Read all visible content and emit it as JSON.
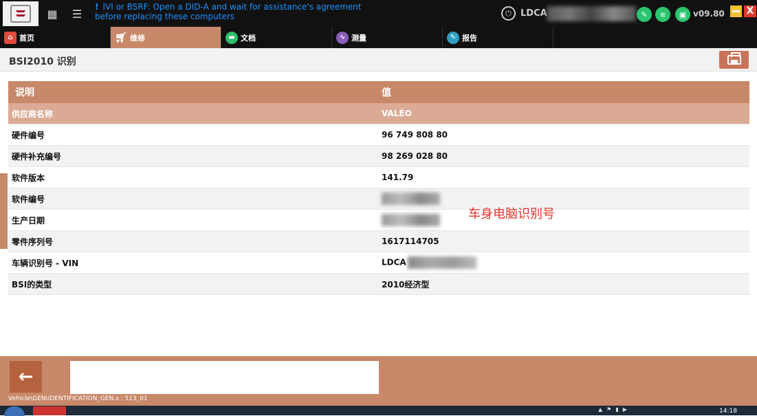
{
  "topbar": {
    "message_bang": "!",
    "message": "IVI or BSRF: Open a DID-A and wait for assistance's agreement before replacing these computers",
    "vin_prefix": "LDCA",
    "version": "v09.80",
    "close_glyph": "X"
  },
  "tabs": [
    {
      "label": "首页",
      "icon": "home-icon"
    },
    {
      "label": "维修",
      "icon": "cart-icon",
      "active": true
    },
    {
      "label": "文档",
      "icon": "folder-icon"
    },
    {
      "label": "测量",
      "icon": "waveform-icon"
    },
    {
      "label": "报告",
      "icon": "report-icon"
    }
  ],
  "page": {
    "title": "BSI2010 识别"
  },
  "table": {
    "header": {
      "col1": "说明",
      "col2": "值"
    },
    "rows": [
      {
        "label": "供应商名称",
        "value": "VALÉO"
      },
      {
        "label": "硬件编号",
        "value": "96 749 808 80"
      },
      {
        "label": "硬件补充编号",
        "value": "98 269 028 80"
      },
      {
        "label": "软件版本",
        "value": "141.79"
      },
      {
        "label": "软件编号",
        "value": ""
      },
      {
        "label": "生产日期",
        "value": ""
      },
      {
        "label": "零件序列号",
        "value": "1617114705"
      },
      {
        "label": "车辆识别号 - VIN",
        "value": "LDCA"
      },
      {
        "label": "BSI的类型",
        "value": "2010经济型"
      }
    ]
  },
  "annotation": "车身电脑识别号",
  "footer": {
    "back_glyph": "←",
    "path": "Vehicle\\GEN\\IDENTIFICATION_GEN.s : 513_01"
  },
  "taskbar": {
    "clock": "14:18"
  },
  "colors": {
    "accent": "#c8886a",
    "header_row": "#dbaa94",
    "message": "#1e90ff",
    "annotation": "#e0322a"
  }
}
